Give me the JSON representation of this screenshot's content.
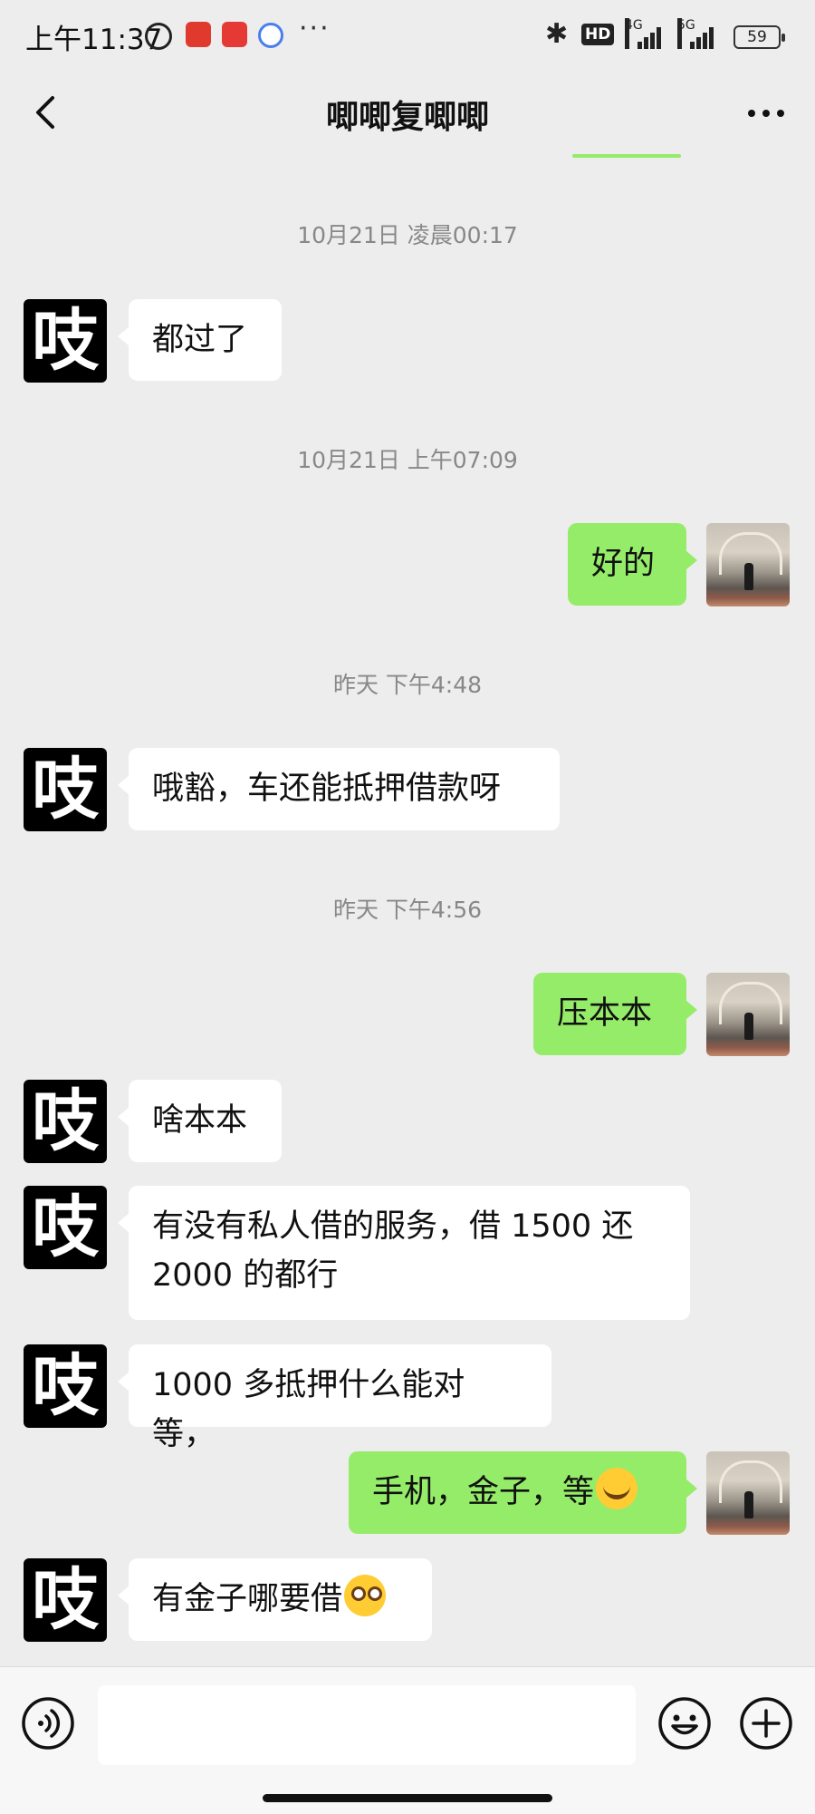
{
  "status_bar": {
    "time": "上午11:37",
    "more": "···",
    "hd": "HD",
    "net1": "4G",
    "net2": "5G",
    "battery": "59"
  },
  "header": {
    "title": "唧唧复唧唧",
    "back_icon": "chevron-left-icon",
    "more_icon": "more-dots-icon"
  },
  "colors": {
    "background": "#ededed",
    "bubble_in": "#ffffff",
    "bubble_out": "#95ec69"
  },
  "messages": {
    "ts1": "10月21日 凌晨00:17",
    "m1": "都过了",
    "ts2": "10月21日 上午07:09",
    "m2": "好的",
    "ts3": "昨天 下午4:48",
    "m3": "哦豁，车还能抵押借款呀",
    "ts4": "昨天 下午4:56",
    "m4": "压本本",
    "m5": "啥本本",
    "m6": "有没有私人借的服务，借 1500 还 2000 的都行",
    "m7": "1000 多抵押什么能对等，",
    "m8": "手机，金子，等",
    "m9": "有金子哪要借"
  },
  "contact_avatar_char": "吱",
  "input": {
    "value": "",
    "voice_icon": "voice-icon",
    "emoji_icon": "emoji-icon",
    "plus_icon": "plus-icon"
  }
}
